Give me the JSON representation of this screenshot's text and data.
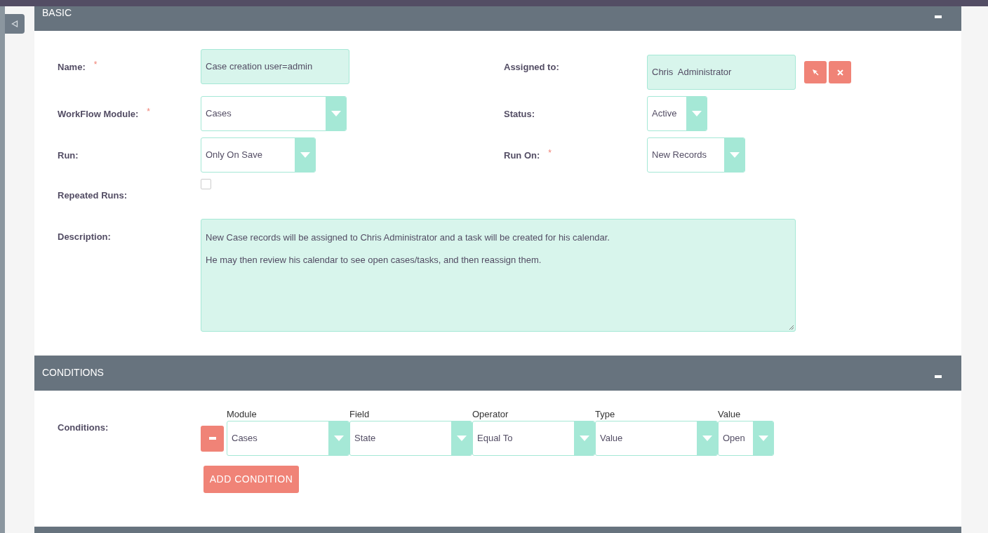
{
  "basic_panel": {
    "title": "BASIC",
    "expanded": true,
    "fields": [
      {
        "kind": "text",
        "label": "Name:",
        "required_mark": "*",
        "value": "Case creation user=admin"
      },
      {
        "kind": "relate",
        "label": "Assigned to:",
        "value": "Chris  Administrator"
      },
      {
        "kind": "select",
        "label": "WorkFlow Module:",
        "required_mark": "*",
        "value": "Cases"
      },
      {
        "kind": "select",
        "label": "Status:",
        "value": "Active"
      },
      {
        "kind": "select",
        "label": "Run:",
        "value": "Only On Save"
      },
      {
        "kind": "select",
        "label": "Run On:",
        "required_mark": "*",
        "value": "New Records"
      },
      {
        "kind": "checkbox",
        "label": "Repeated Runs:",
        "checked": false
      },
      {
        "kind": "textarea",
        "label": "Description:",
        "value": "New Case records will be assigned to Chris Administrator and a task will be created for his calendar.\n\nHe may then review his calendar to see open cases/tasks, and then reassign them."
      }
    ]
  },
  "conditions_panel": {
    "title": "CONDITIONS",
    "expanded": true,
    "label": "Conditions:",
    "columns": [
      "Module",
      "Field",
      "Operator",
      "Type",
      "Value"
    ],
    "rows": [
      {
        "values": [
          "Cases",
          "State",
          "Equal To",
          "Value",
          "Open"
        ]
      }
    ],
    "add_button": "ADD CONDITION"
  }
}
